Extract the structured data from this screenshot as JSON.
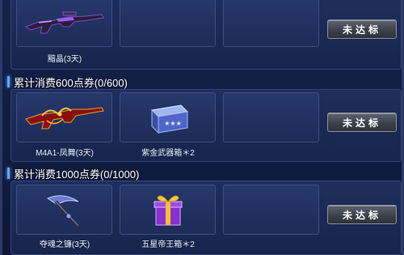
{
  "tiers": [
    {
      "title": "",
      "rewards": [
        {
          "name": "黯晶(3天)",
          "icon": "purple-rifle-icon"
        }
      ],
      "status_label": "未达标"
    },
    {
      "title": "累计消费600点券(0/600)",
      "rewards": [
        {
          "name": "M4A1-凤舞(3天)",
          "icon": "red-gold-rifle-icon"
        },
        {
          "name": "紫金武器箱＊2",
          "icon": "blue-weapon-box-icon"
        }
      ],
      "status_label": "未达标"
    },
    {
      "title": "累计消费1000点券(0/1000)",
      "rewards": [
        {
          "name": "夺魂之镰(3天)",
          "icon": "dark-scythe-icon"
        },
        {
          "name": "五星帝王箱＊2",
          "icon": "purple-gift-box-icon"
        }
      ],
      "status_label": "未达标"
    }
  ],
  "colors": {
    "background": "#0f1a34",
    "panel": "#1e2f5c",
    "slot": "#26386a",
    "header_marker": "#5fa8ff",
    "button": "#4a505c"
  }
}
